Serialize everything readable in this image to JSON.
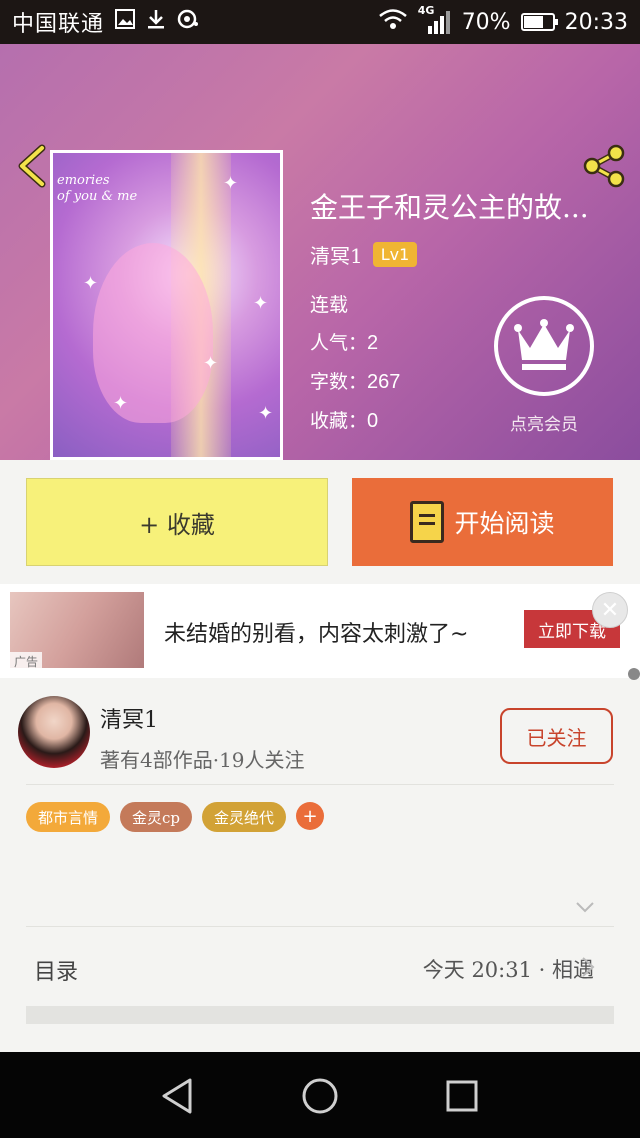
{
  "status_bar": {
    "carrier": "中国联通",
    "network": "4G",
    "battery": "70%",
    "battery_level": 0.7,
    "time": "20:33"
  },
  "book": {
    "title": "金王子和灵公主的故...",
    "author": "清冥1",
    "level": "Lv1",
    "status": "连载",
    "popularity_label": "人气：",
    "popularity": "2",
    "word_count_label": "字数：",
    "word_count": "267",
    "favorites_label": "收藏：",
    "favorites": "0",
    "cover_text": "emories\nof you & me",
    "vip_label": "点亮会员"
  },
  "actions": {
    "collect_label": "+ 收藏",
    "read_label": "开始阅读"
  },
  "ad": {
    "tag": "广告",
    "text": "未结婚的别看，内容太刺激了~",
    "cta": "立即下载"
  },
  "author_card": {
    "name": "清冥1",
    "stats": "著有4部作品·19人关注",
    "follow_label": "已关注"
  },
  "tags": [
    {
      "label": "都市言情",
      "color": "#f3a93a"
    },
    {
      "label": "金灵cp",
      "color": "#c47a5a"
    },
    {
      "label": "金灵绝代",
      "color": "#d2a236"
    }
  ],
  "tag_add": "+",
  "toc": {
    "label": "目录",
    "latest": "今天 20:31 · 相遇"
  },
  "colors": {
    "accent_orange": "#ea6d3a",
    "collect_yellow": "#f7f17a",
    "follow_red": "#c8442c"
  }
}
